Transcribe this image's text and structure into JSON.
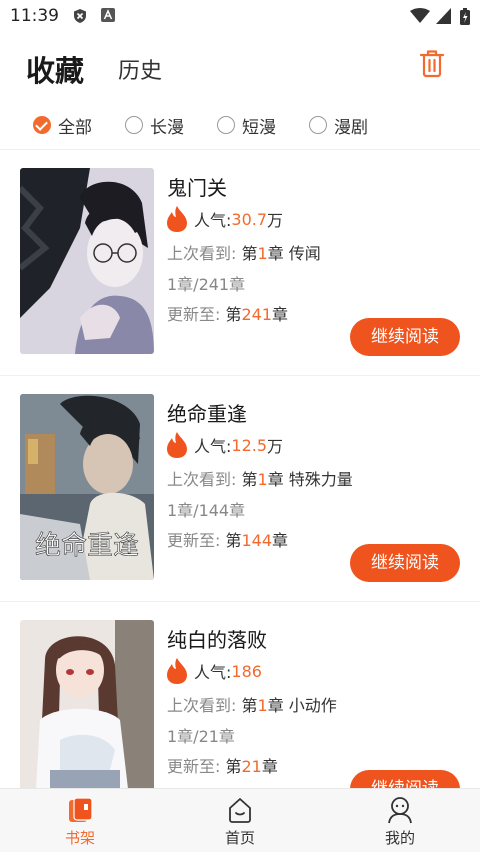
{
  "status_bar": {
    "time": "11:39"
  },
  "header": {
    "tab_favorites": "收藏",
    "tab_history": "历史"
  },
  "filters": [
    {
      "label": "全部",
      "checked": true
    },
    {
      "label": "长漫",
      "checked": false
    },
    {
      "label": "短漫",
      "checked": false
    },
    {
      "label": "漫剧",
      "checked": false
    }
  ],
  "labels": {
    "popularity": "人气: ",
    "last_read_prefix": "上次看到: ",
    "update_prefix": "更新至: ",
    "chapter_prefix": "第",
    "chapter_suffix": "章",
    "continue_button": "继续阅读"
  },
  "comics": [
    {
      "title": "鬼门关",
      "pop_num": "30.7",
      "pop_unit": "万",
      "last_chapter": "1",
      "last_chapter_title": " 传闻",
      "progress": "1章/241章",
      "latest_chapter": "241"
    },
    {
      "title": "绝命重逢",
      "pop_num": "12.5",
      "pop_unit": "万",
      "last_chapter": "1",
      "last_chapter_title": " 特殊力量",
      "progress": "1章/144章",
      "latest_chapter": "144",
      "cover_text": "绝命重逢"
    },
    {
      "title": "纯白的落败",
      "pop_num": "186",
      "pop_unit": "",
      "last_chapter": "1",
      "last_chapter_title": " 小动作",
      "progress": "1章/21章",
      "latest_chapter": "21"
    }
  ],
  "bottom_nav": [
    {
      "label": "书架",
      "active": true
    },
    {
      "label": "首页",
      "active": false
    },
    {
      "label": "我的",
      "active": false
    }
  ],
  "colors": {
    "accent": "#f26a2e",
    "button": "#f0541e"
  }
}
